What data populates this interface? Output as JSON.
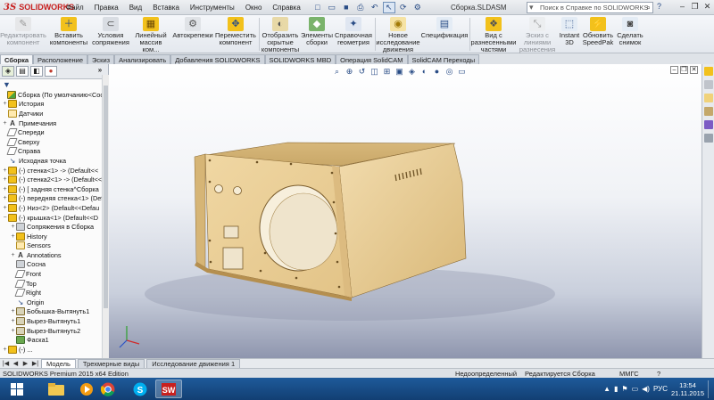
{
  "app": {
    "logo_text": "SOLIDWORKS",
    "doc_title": "Сборка.SLDASM",
    "search_placeholder": "Поиск в Справке по SOLIDWORKS",
    "menu": [
      "Файл",
      "Правка",
      "Вид",
      "Вставка",
      "Инструменты",
      "Окно",
      "Справка"
    ]
  },
  "commands": [
    {
      "label": "Редактировать компонент",
      "l1": "Редактировать",
      "l2": "компонент",
      "disabled": true
    },
    {
      "label": "Вставить компоненты",
      "l1": "Вставить",
      "l2": "компоненты"
    },
    {
      "label": "Условия сопряжения",
      "l1": "Условия",
      "l2": "сопряжения"
    },
    {
      "label": "Линейный массив ком...",
      "l1": "Линейный",
      "l2": "массив ком..."
    },
    {
      "label": "Автокрепежи",
      "l1": "Автокрепежи",
      "l2": ""
    },
    {
      "label": "Переместить компонент",
      "l1": "Переместить",
      "l2": "компонент"
    },
    {
      "label": "Отобразить скрытые компоненты",
      "l1": "Отобразить",
      "l2": "скрытые",
      "l3": "компоненты"
    },
    {
      "label": "Элементы сборки",
      "l1": "Элементы",
      "l2": "сборки"
    },
    {
      "label": "Справочная геометрия",
      "l1": "Справочная",
      "l2": "геометрия"
    },
    {
      "label": "Новое исследование движения",
      "l1": "Новое",
      "l2": "исследование",
      "l3": "движения"
    },
    {
      "label": "Спецификация",
      "l1": "Спецификация",
      "l2": ""
    },
    {
      "label": "Вид с разнесенными частями",
      "l1": "Вид с",
      "l2": "разнесенными",
      "l3": "частями"
    },
    {
      "label": "Эскиз с линиями разнесения",
      "l1": "Эскиз с",
      "l2": "линиями",
      "l3": "разнесения",
      "disabled": true
    },
    {
      "label": "Instant 3D",
      "l1": "Instant",
      "l2": "3D"
    },
    {
      "label": "Обновить SpeedPak",
      "l1": "Обновить",
      "l2": "SpeedPak"
    },
    {
      "label": "Сделать снимок",
      "l1": "Сделать",
      "l2": "снимок"
    }
  ],
  "tabs": [
    "Сборка",
    "Расположение",
    "Эскиз",
    "Анализировать",
    "Добавления SOLIDWORKS",
    "SOLIDWORKS MBD",
    "Операция SolidCAM",
    "SolidCAM Переходы"
  ],
  "tree": [
    {
      "label": "Сборка  (По умолчанию<Сост",
      "icon": "asm",
      "exp": "",
      "indent": 0
    },
    {
      "label": "История",
      "icon": "yel",
      "exp": "+",
      "indent": 1
    },
    {
      "label": "Датчики",
      "icon": "sens",
      "exp": "",
      "indent": 1
    },
    {
      "label": "Примечания",
      "icon": "ann",
      "exp": "+",
      "indent": 1
    },
    {
      "label": "Спереди",
      "icon": "plane",
      "exp": "",
      "indent": 1
    },
    {
      "label": "Сверху",
      "icon": "plane",
      "exp": "",
      "indent": 1
    },
    {
      "label": "Справа",
      "icon": "plane",
      "exp": "",
      "indent": 1
    },
    {
      "label": "Исходная точка",
      "icon": "org",
      "exp": "",
      "indent": 1
    },
    {
      "label": "(-) стенка<1> -> (Default<<",
      "icon": "yel",
      "exp": "+",
      "indent": 1
    },
    {
      "label": "(-) стенка2<1> -> (Default<<",
      "icon": "yel",
      "exp": "+",
      "indent": 1
    },
    {
      "label": "(-) [ задняя стенка^Сборка",
      "icon": "yel",
      "exp": "+",
      "indent": 1
    },
    {
      "label": "(-) передняя стенка<1> (Defa",
      "icon": "yel",
      "exp": "+",
      "indent": 1
    },
    {
      "label": "(-) Низ<2> (Default<<Defau",
      "icon": "yel",
      "exp": "+",
      "indent": 1
    },
    {
      "label": "(-) крышка<1> (Default<<D",
      "icon": "yel",
      "exp": "−",
      "indent": 1
    },
    {
      "label": "Сопряжения в Сборка",
      "icon": "mat",
      "exp": "+",
      "indent": 2
    },
    {
      "label": "History",
      "icon": "yel",
      "exp": "+",
      "indent": 2
    },
    {
      "label": "Sensors",
      "icon": "sens",
      "exp": "",
      "indent": 2
    },
    {
      "label": "Annotations",
      "icon": "ann",
      "exp": "+",
      "indent": 2
    },
    {
      "label": "Сосна",
      "icon": "mat",
      "exp": "",
      "indent": 2
    },
    {
      "label": "Front",
      "icon": "plane",
      "exp": "",
      "indent": 2
    },
    {
      "label": "Top",
      "icon": "plane",
      "exp": "",
      "indent": 2
    },
    {
      "label": "Right",
      "icon": "plane",
      "exp": "",
      "indent": 2
    },
    {
      "label": "Origin",
      "icon": "org",
      "exp": "",
      "indent": 2
    },
    {
      "label": "Бобышка-Вытянуть1",
      "icon": "feat",
      "exp": "+",
      "indent": 2
    },
    {
      "label": "Вырез-Вытянуть1",
      "icon": "feat",
      "exp": "+",
      "indent": 2
    },
    {
      "label": "Вырез-Вытянуть2",
      "icon": "feat",
      "exp": "+",
      "indent": 2
    },
    {
      "label": "Фаска1",
      "icon": "fil",
      "exp": "",
      "indent": 2
    },
    {
      "label": "(-) ...",
      "icon": "yel",
      "exp": "+",
      "indent": 1
    }
  ],
  "bottom_tabs": [
    "Модель",
    "Трехмерные виды",
    "Исследование движения 1"
  ],
  "status": {
    "edition": "SOLIDWORKS Premium 2015 x64 Edition",
    "defined": "Недоопределенный",
    "editing": "Редактируется Сборка",
    "units": "ММГС",
    "help": "?"
  },
  "taskbar": {
    "lang": "РУС",
    "time": "13:54",
    "date": "21.11.2015"
  },
  "colors": {
    "wood": "#e9cf9a",
    "wood_dark": "#c9a869",
    "accent": "#2a4d86"
  }
}
